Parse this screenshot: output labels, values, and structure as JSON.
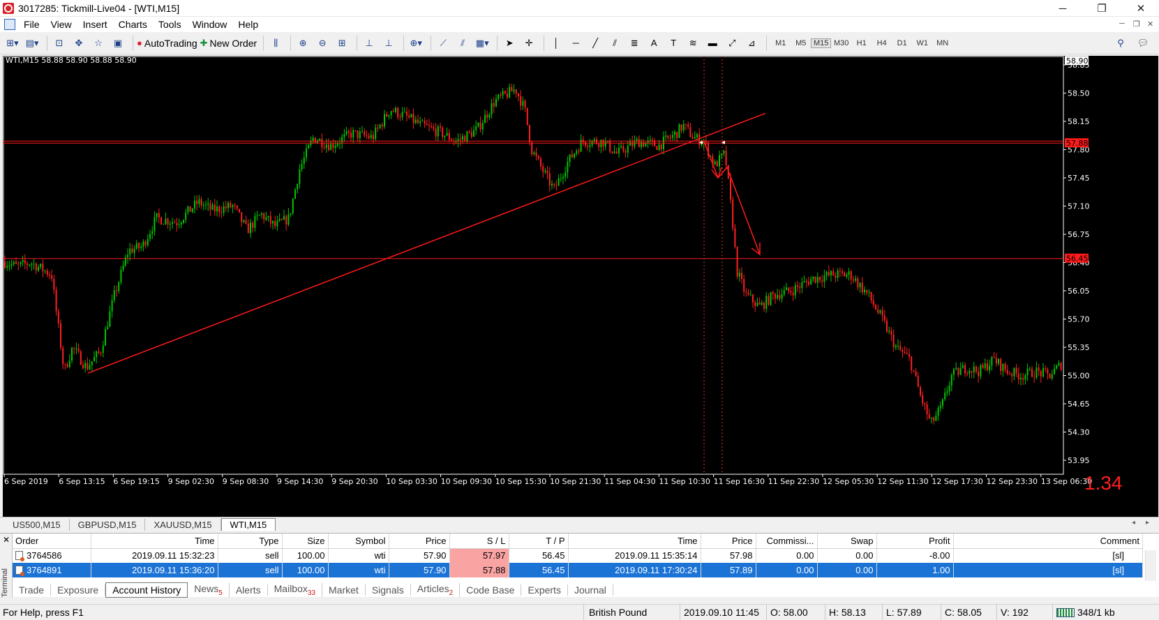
{
  "window": {
    "title": "3017285: Tickmill-Live04 - [WTI,M15]",
    "minimize": "─",
    "maximize": "❐",
    "close": "✕"
  },
  "menu": [
    "File",
    "View",
    "Insert",
    "Charts",
    "Tools",
    "Window",
    "Help"
  ],
  "toolbar": {
    "autotrading": "AutoTrading",
    "new_order": "New Order",
    "timeframes": [
      "M1",
      "M5",
      "M15",
      "M30",
      "H1",
      "H4",
      "D1",
      "W1",
      "MN"
    ],
    "active_timeframe": "M15"
  },
  "chart": {
    "header": "WTI,M15  58.88 58.90 58.88 58.90",
    "price_labels": [
      "58.85",
      "58.50",
      "58.15",
      "57.80",
      "57.45",
      "57.10",
      "56.75",
      "56.40",
      "56.05",
      "55.70",
      "55.35",
      "55.00",
      "54.65",
      "54.30",
      "53.95"
    ],
    "current_price": "58.90",
    "level_labels": [
      "57.88",
      "56.45"
    ],
    "time_labels": [
      "6 Sep 2019",
      "6 Sep 13:15",
      "6 Sep 19:15",
      "9 Sep 02:30",
      "9 Sep 08:30",
      "9 Sep 14:30",
      "9 Sep 20:30",
      "10 Sep 03:30",
      "10 Sep 09:30",
      "10 Sep 15:30",
      "10 Sep 21:30",
      "11 Sep 04:30",
      "11 Sep 10:30",
      "11 Sep 16:30",
      "11 Sep 22:30",
      "12 Sep 05:30",
      "12 Sep 11:30",
      "12 Sep 17:30",
      "12 Sep 23:30",
      "13 Sep 06:30"
    ],
    "overlay_value": "1.34",
    "colors": {
      "bull": "#00c800",
      "bear": "#ff2020",
      "background": "#000000",
      "lines": "#ff1a1a"
    }
  },
  "chart_tabs": [
    "US500,M15",
    "GBPUSD,M15",
    "XAUUSD,M15",
    "WTI,M15"
  ],
  "terminal": {
    "side_label": "Terminal",
    "columns": [
      "Order",
      "Time",
      "Type",
      "Size",
      "Symbol",
      "Price",
      "S / L",
      "T / P",
      "Time",
      "Price",
      "Commissi...",
      "Swap",
      "Profit",
      "Comment"
    ],
    "rows": [
      [
        "3764586",
        "2019.09.11 15:32:23",
        "sell",
        "100.00",
        "wti",
        "57.90",
        "57.97",
        "56.45",
        "2019.09.11 15:35:14",
        "57.98",
        "0.00",
        "0.00",
        "-8.00",
        "[sl]"
      ],
      [
        "3764891",
        "2019.09.11 15:36:20",
        "sell",
        "100.00",
        "wti",
        "57.90",
        "57.88",
        "56.45",
        "2019.09.11 17:30:24",
        "57.89",
        "0.00",
        "0.00",
        "1.00",
        "[sl]"
      ]
    ],
    "tabs": [
      {
        "label": "Trade",
        "badge": ""
      },
      {
        "label": "Exposure",
        "badge": ""
      },
      {
        "label": "Account History",
        "badge": ""
      },
      {
        "label": "News",
        "badge": "5"
      },
      {
        "label": "Alerts",
        "badge": ""
      },
      {
        "label": "Mailbox",
        "badge": "33"
      },
      {
        "label": "Market",
        "badge": ""
      },
      {
        "label": "Signals",
        "badge": ""
      },
      {
        "label": "Articles",
        "badge": "2"
      },
      {
        "label": "Code Base",
        "badge": ""
      },
      {
        "label": "Experts",
        "badge": ""
      },
      {
        "label": "Journal",
        "badge": ""
      }
    ]
  },
  "status": {
    "help": "For Help, press F1",
    "profile": "British Pound",
    "time": "2019.09.10 11:45",
    "open": "O: 58.00",
    "high": "H: 58.13",
    "low": "L: 57.89",
    "close": "C: 58.05",
    "volume": "V: 192",
    "traffic": "348/1 kb"
  }
}
